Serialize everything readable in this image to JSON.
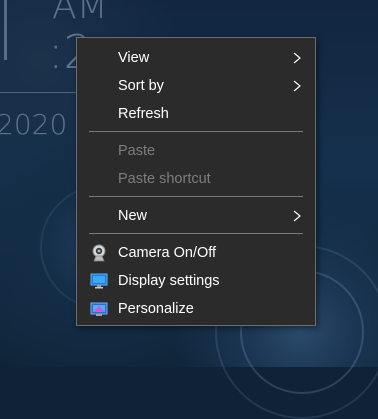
{
  "desktop": {
    "clock_ampm": "AM",
    "clock_time": ":2",
    "clock_year": "2020"
  },
  "context_menu": {
    "items": [
      {
        "label": "View",
        "enabled": true,
        "submenu": true
      },
      {
        "label": "Sort by",
        "enabled": true,
        "submenu": true
      },
      {
        "label": "Refresh",
        "enabled": true,
        "submenu": false
      },
      {
        "label": "Paste",
        "enabled": false,
        "submenu": false
      },
      {
        "label": "Paste shortcut",
        "enabled": false,
        "submenu": false
      },
      {
        "label": "New",
        "enabled": true,
        "submenu": true
      },
      {
        "label": "Camera On/Off",
        "enabled": true,
        "icon": "webcam-icon"
      },
      {
        "label": "Display settings",
        "enabled": true,
        "icon": "display-settings-icon"
      },
      {
        "label": "Personalize",
        "enabled": true,
        "icon": "personalize-icon"
      }
    ]
  },
  "colors": {
    "menu_background": "#2b2b2b",
    "menu_border": "#6d6d6d",
    "text_enabled": "#ffffff",
    "text_disabled": "#7d7d7d",
    "separator": "#7a7a7a"
  }
}
